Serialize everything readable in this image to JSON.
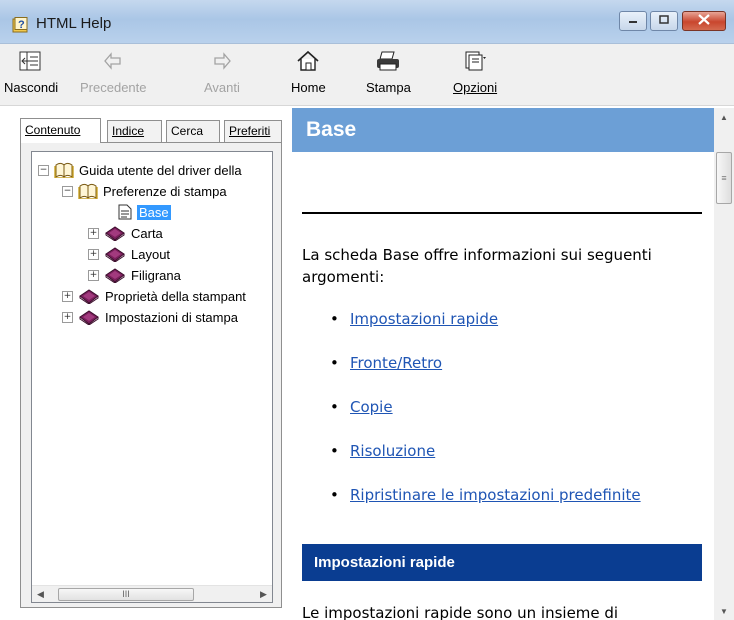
{
  "window": {
    "title": "HTML Help",
    "controls": {
      "minimize": "minimize-icon",
      "maximize": "maximize-icon",
      "close": "close-icon"
    }
  },
  "toolbar": {
    "hide_label": "Nascondi",
    "back_label": "Precedente",
    "forward_label": "Avanti",
    "home_label": "Home",
    "print_label": "Stampa",
    "options_label": "Opzioni"
  },
  "tabs": {
    "contents": "Contenuto",
    "index": "Indice",
    "search": "Cerca",
    "favorites": "Preferiti"
  },
  "tree": {
    "root": "Guida utente del driver della",
    "print_prefs": "Preferenze di stampa",
    "base": "Base",
    "paper": "Carta",
    "layout": "Layout",
    "watermark": "Filigrana",
    "printer_props": "Proprietà della stampant",
    "print_settings": "Impostazioni di stampa"
  },
  "scrollbar": {
    "grip": "III"
  },
  "content": {
    "heading": "Base",
    "intro": "La scheda Base offre informazioni sui seguenti argomenti:",
    "links": [
      "Impostazioni rapide",
      "Fronte/Retro",
      "Copie",
      "Risoluzione",
      "Ripristinare le impostazioni predefinite"
    ],
    "section_heading": "Impostazioni rapide",
    "section_text": "Le impostazioni rapide sono un insieme di"
  },
  "colors": {
    "header_blue": "#6c9fd6",
    "section_navy": "#0a3d91",
    "link": "#1f55b4",
    "selection": "#3399ff"
  }
}
